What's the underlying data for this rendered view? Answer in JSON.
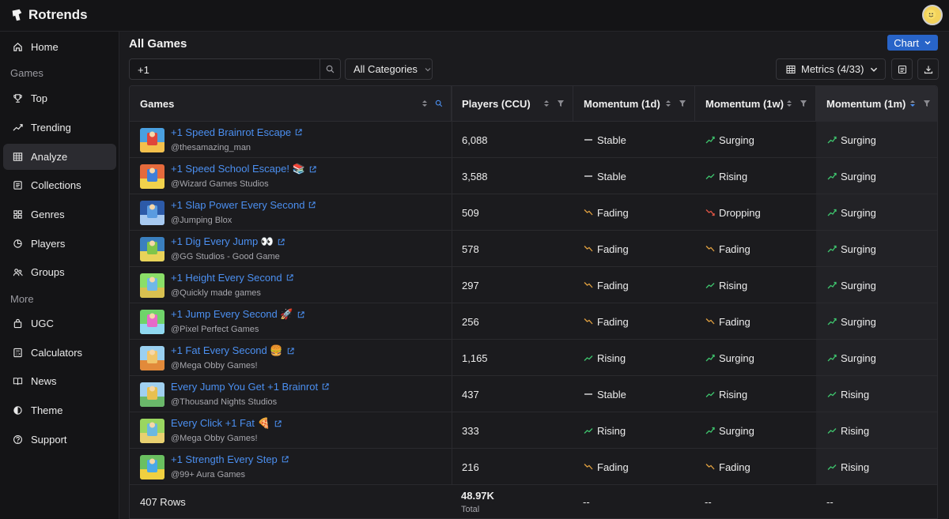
{
  "app": {
    "name": "Rotrends"
  },
  "sidebar": {
    "home": "Home",
    "section_games": "Games",
    "games_items": [
      {
        "label": "Top",
        "icon": "trophy-icon"
      },
      {
        "label": "Trending",
        "icon": "trending-icon"
      },
      {
        "label": "Analyze",
        "icon": "table-icon",
        "active": true
      },
      {
        "label": "Collections",
        "icon": "collection-icon"
      },
      {
        "label": "Genres",
        "icon": "grid-icon"
      },
      {
        "label": "Players",
        "icon": "pie-icon"
      },
      {
        "label": "Groups",
        "icon": "groups-icon"
      }
    ],
    "section_more": "More",
    "more_items": [
      {
        "label": "UGC",
        "icon": "bag-icon"
      },
      {
        "label": "Calculators",
        "icon": "calculator-icon"
      },
      {
        "label": "News",
        "icon": "book-icon"
      },
      {
        "label": "Theme",
        "icon": "theme-icon"
      },
      {
        "label": "Support",
        "icon": "help-icon"
      }
    ]
  },
  "main": {
    "title": "All Games",
    "chart_button": "Chart",
    "search_value": "+1",
    "category": "All Categories",
    "metrics": "Metrics (4/33)"
  },
  "table": {
    "headers": [
      "Games",
      "Players (CCU)",
      "Momentum (1d)",
      "Momentum (1w)",
      "Momentum (1m)"
    ],
    "rows": [
      {
        "title": "+1 Speed Brainrot Escape",
        "dev": "@thesamazing_man",
        "ccu": "6,088",
        "m1d": "Stable",
        "m1w": "Surging",
        "m1m": "Surging"
      },
      {
        "title": "+1 Speed School Escape! 📚",
        "dev": "@Wizard Games Studios",
        "ccu": "3,588",
        "m1d": "Stable",
        "m1w": "Rising",
        "m1m": "Surging"
      },
      {
        "title": "+1 Slap Power Every Second",
        "dev": "@Jumping Blox",
        "ccu": "509",
        "m1d": "Fading",
        "m1w": "Dropping",
        "m1m": "Surging"
      },
      {
        "title": "+1 Dig Every Jump 👀",
        "dev": "@GG Studios - Good Game",
        "ccu": "578",
        "m1d": "Fading",
        "m1w": "Fading",
        "m1m": "Surging"
      },
      {
        "title": "+1 Height Every Second",
        "dev": "@Quickly made games",
        "ccu": "297",
        "m1d": "Fading",
        "m1w": "Rising",
        "m1m": "Surging"
      },
      {
        "title": "+1 Jump Every Second 🚀",
        "dev": "@Pixel Perfect Games",
        "ccu": "256",
        "m1d": "Fading",
        "m1w": "Fading",
        "m1m": "Surging"
      },
      {
        "title": "+1 Fat Every Second 🍔",
        "dev": "@Mega Obby Games!",
        "ccu": "1,165",
        "m1d": "Rising",
        "m1w": "Surging",
        "m1m": "Surging"
      },
      {
        "title": "Every Jump You Get +1 Brainrot",
        "dev": "@Thousand Nights Studios",
        "ccu": "437",
        "m1d": "Stable",
        "m1w": "Rising",
        "m1m": "Rising"
      },
      {
        "title": "Every Click +1 Fat 🍕",
        "dev": "@Mega Obby Games!",
        "ccu": "333",
        "m1d": "Rising",
        "m1w": "Surging",
        "m1m": "Rising"
      },
      {
        "title": "+1 Strength Every Step",
        "dev": "@99+ Aura Games",
        "ccu": "216",
        "m1d": "Fading",
        "m1w": "Fading",
        "m1m": "Rising"
      }
    ],
    "footer": {
      "rows": "407 Rows",
      "total": "48.97K",
      "total_label": "Total",
      "dash": "--"
    }
  },
  "colors": {
    "accent": "#2864c8",
    "link": "#4b8ff0",
    "up": "#3ec46d",
    "down_fading": "#e0a040",
    "down_dropping": "#e05545"
  }
}
